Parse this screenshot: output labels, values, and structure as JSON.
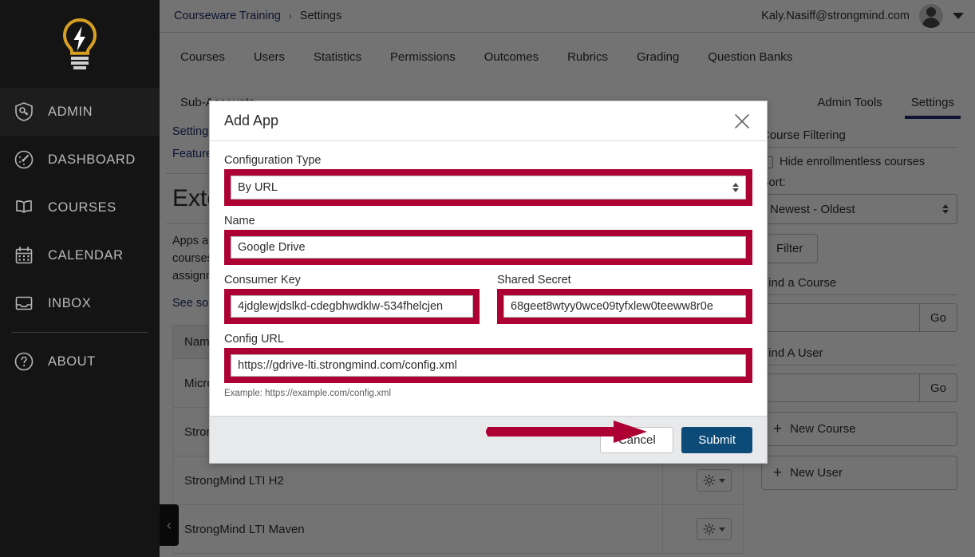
{
  "colors": {
    "annotation_red": "#AD0033",
    "submit_blue": "#0C4A77",
    "nav_dark": "#141414",
    "link_blue": "#1C2A6B",
    "tab_underline": "#1F2A73"
  },
  "global_nav": {
    "logo_name": "lightbulb-logo",
    "items": [
      {
        "label": "ADMIN",
        "icon": "shield-key-icon",
        "active": true
      },
      {
        "label": "DASHBOARD",
        "icon": "speedometer-icon",
        "active": false
      },
      {
        "label": "COURSES",
        "icon": "book-icon",
        "active": false
      },
      {
        "label": "CALENDAR",
        "icon": "calendar-icon",
        "active": false
      },
      {
        "label": "INBOX",
        "icon": "inbox-icon",
        "active": false
      }
    ],
    "secondary": [
      {
        "label": "ABOUT",
        "icon": "question-circle-icon"
      }
    ],
    "collapse_glyph": "‹"
  },
  "topbar": {
    "breadcrumb": {
      "root": "Courseware Training",
      "separator": "›",
      "current": "Settings"
    },
    "user_email": "Kaly.Nasiff@strongmind.com",
    "avatar_name": "user-avatar",
    "chevron": "chevron-down-icon"
  },
  "sub_nav": {
    "items": [
      "Courses",
      "Users",
      "Statistics",
      "Permissions",
      "Outcomes",
      "Rubrics",
      "Grading",
      "Question Banks"
    ]
  },
  "account_nav": {
    "tabs": [
      {
        "label": "Sub-Accounts",
        "active": false
      },
      {
        "label": "Admin Tools",
        "active": false
      },
      {
        "label": "Settings",
        "active": true
      }
    ]
  },
  "content": {
    "side_links": [
      "Settings",
      "Feature Options"
    ],
    "page_title": "External Apps",
    "blurb_line1": "Apps are an easy way to add new features to Canvas. They can be added to individual",
    "blurb_line2": "courses, or to all courses in an account. Once configured, you can link to them through",
    "blurb_line3": "assignments and modules.",
    "blurb_link": "See some LTI apps that can be added to Canvas",
    "table": {
      "header": [
        "Name",
        ""
      ],
      "rows": [
        {
          "name": "Microsoft OneDrive",
          "action_icon": "gear-icon"
        },
        {
          "name": "StrongMind LTI Atlas",
          "action_icon": "gear-icon"
        },
        {
          "name": "StrongMind LTI H2",
          "action_icon": "gear-icon"
        },
        {
          "name": "StrongMind LTI Maven",
          "action_icon": "gear-icon"
        }
      ]
    }
  },
  "sidebar": {
    "course_filtering": {
      "heading": "Course Filtering",
      "hide_checkbox_label": "Hide enrollmentless courses",
      "sort_label": "Sort:",
      "sort_value": "Newest - Oldest",
      "filter_button": "Filter"
    },
    "find_course": {
      "heading": "Find a Course",
      "input_value": "",
      "placeholder": "",
      "go": "Go"
    },
    "find_user": {
      "heading": "Find A User",
      "input_value": "",
      "placeholder": "",
      "go": "Go"
    },
    "new_course": {
      "label": "New Course",
      "icon": "plus-icon"
    },
    "new_user": {
      "label": "New User",
      "icon": "plus-icon"
    }
  },
  "modal": {
    "title": "Add App",
    "close_icon": "close-icon",
    "fields": {
      "configuration_type": {
        "label": "Configuration Type",
        "value": "By URL",
        "highlighted": true
      },
      "name": {
        "label": "Name",
        "value": "Google Drive",
        "highlighted": true
      },
      "consumer_key": {
        "label": "Consumer Key",
        "value": "4jdglewjdslkd-cdegbhwdklw-534fhelcjen",
        "highlighted": true
      },
      "shared_secret": {
        "label": "Shared Secret",
        "value": "68geet8wtyy0wce09tyfxlew0teeww8r0e",
        "highlighted": true
      },
      "config_url": {
        "label": "Config URL",
        "value": "https://gdrive-lti.strongmind.com/config.xml",
        "highlighted": true,
        "hint": "Example: https://example.com/config.xml"
      }
    },
    "cancel_label": "Cancel",
    "submit_label": "Submit",
    "annotation_arrow": "red-arrow-pointing-to-submit"
  }
}
